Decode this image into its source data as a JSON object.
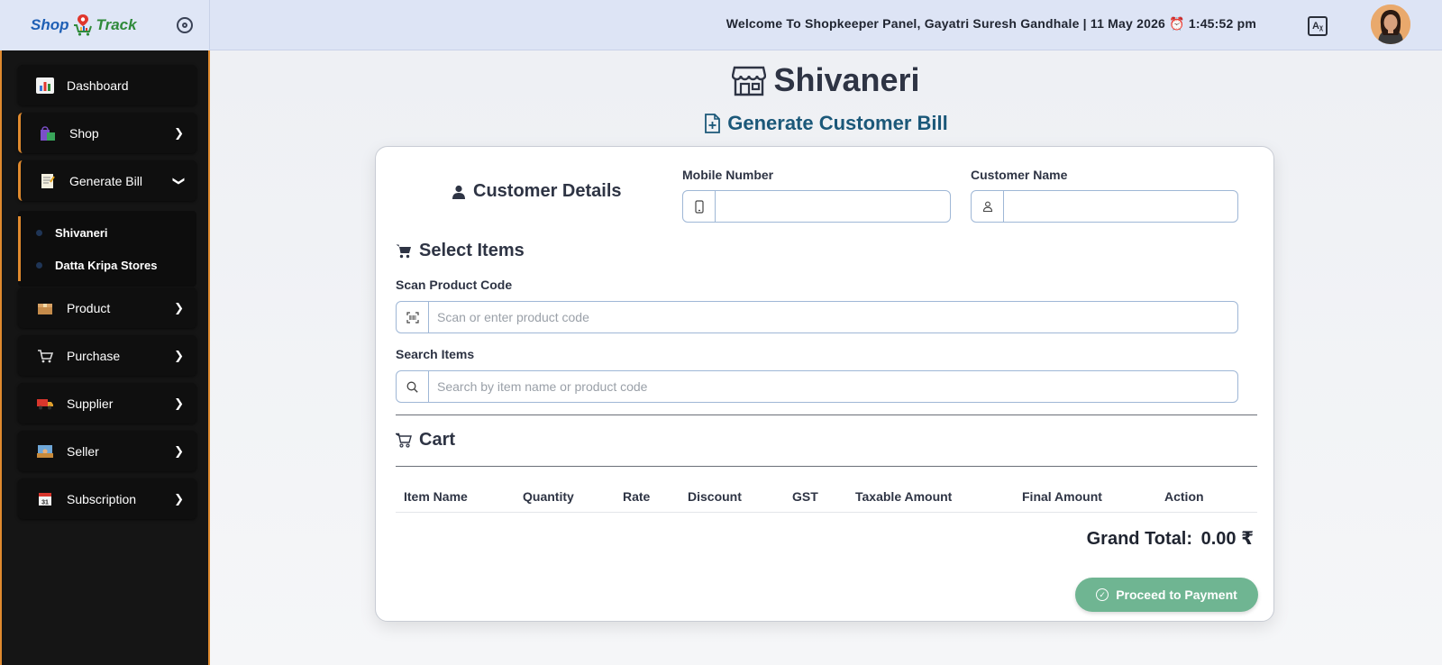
{
  "header": {
    "logo": {
      "part1": "Shop",
      "part2": "Track"
    },
    "welcome_text": "Welcome To Shopkeeper Panel, Gayatri Suresh Gandhale | 11 May 2026 ⏰ 1:45:52 pm",
    "translate_icon": "translate-icon",
    "avatar_icon": "user-avatar"
  },
  "sidebar": {
    "items": [
      {
        "label": "Dashboard",
        "icon": "chart-icon"
      },
      {
        "label": "Shop",
        "icon": "shopping-bags-icon"
      },
      {
        "label": "Generate Bill",
        "icon": "memo-icon"
      },
      {
        "label": "Product",
        "icon": "package-icon"
      },
      {
        "label": "Purchase",
        "icon": "cart-icon"
      },
      {
        "label": "Supplier",
        "icon": "truck-icon"
      },
      {
        "label": "Seller",
        "icon": "seller-icon"
      },
      {
        "label": "Subscription",
        "icon": "calendar-icon"
      }
    ],
    "submenu": [
      {
        "label": "Shivaneri"
      },
      {
        "label": "Datta Kripa Stores"
      }
    ]
  },
  "main": {
    "shop_name": "Shivaneri",
    "page_title": "Generate Customer Bill",
    "customer_details": {
      "heading": "Customer Details",
      "mobile_label": "Mobile Number",
      "mobile_value": "",
      "name_label": "Customer Name",
      "name_value": ""
    },
    "select_items": {
      "heading": "Select Items",
      "scan_label": "Scan Product Code",
      "scan_placeholder": "Scan or enter product code",
      "search_label": "Search Items",
      "search_placeholder": "Search by item name or product code"
    },
    "cart": {
      "heading": "Cart",
      "columns": [
        "Item Name",
        "Quantity",
        "Rate",
        "Discount",
        "GST",
        "Taxable Amount",
        "Final Amount",
        "Action"
      ],
      "rows": [],
      "grand_total_label": "Grand Total:",
      "grand_total_value": "0.00 ₹"
    },
    "proceed_button": "Proceed to Payment"
  },
  "colors": {
    "sidebar_accent": "#e08a2e",
    "page_title": "#1b5879",
    "proceed_button": "#6fb592"
  }
}
